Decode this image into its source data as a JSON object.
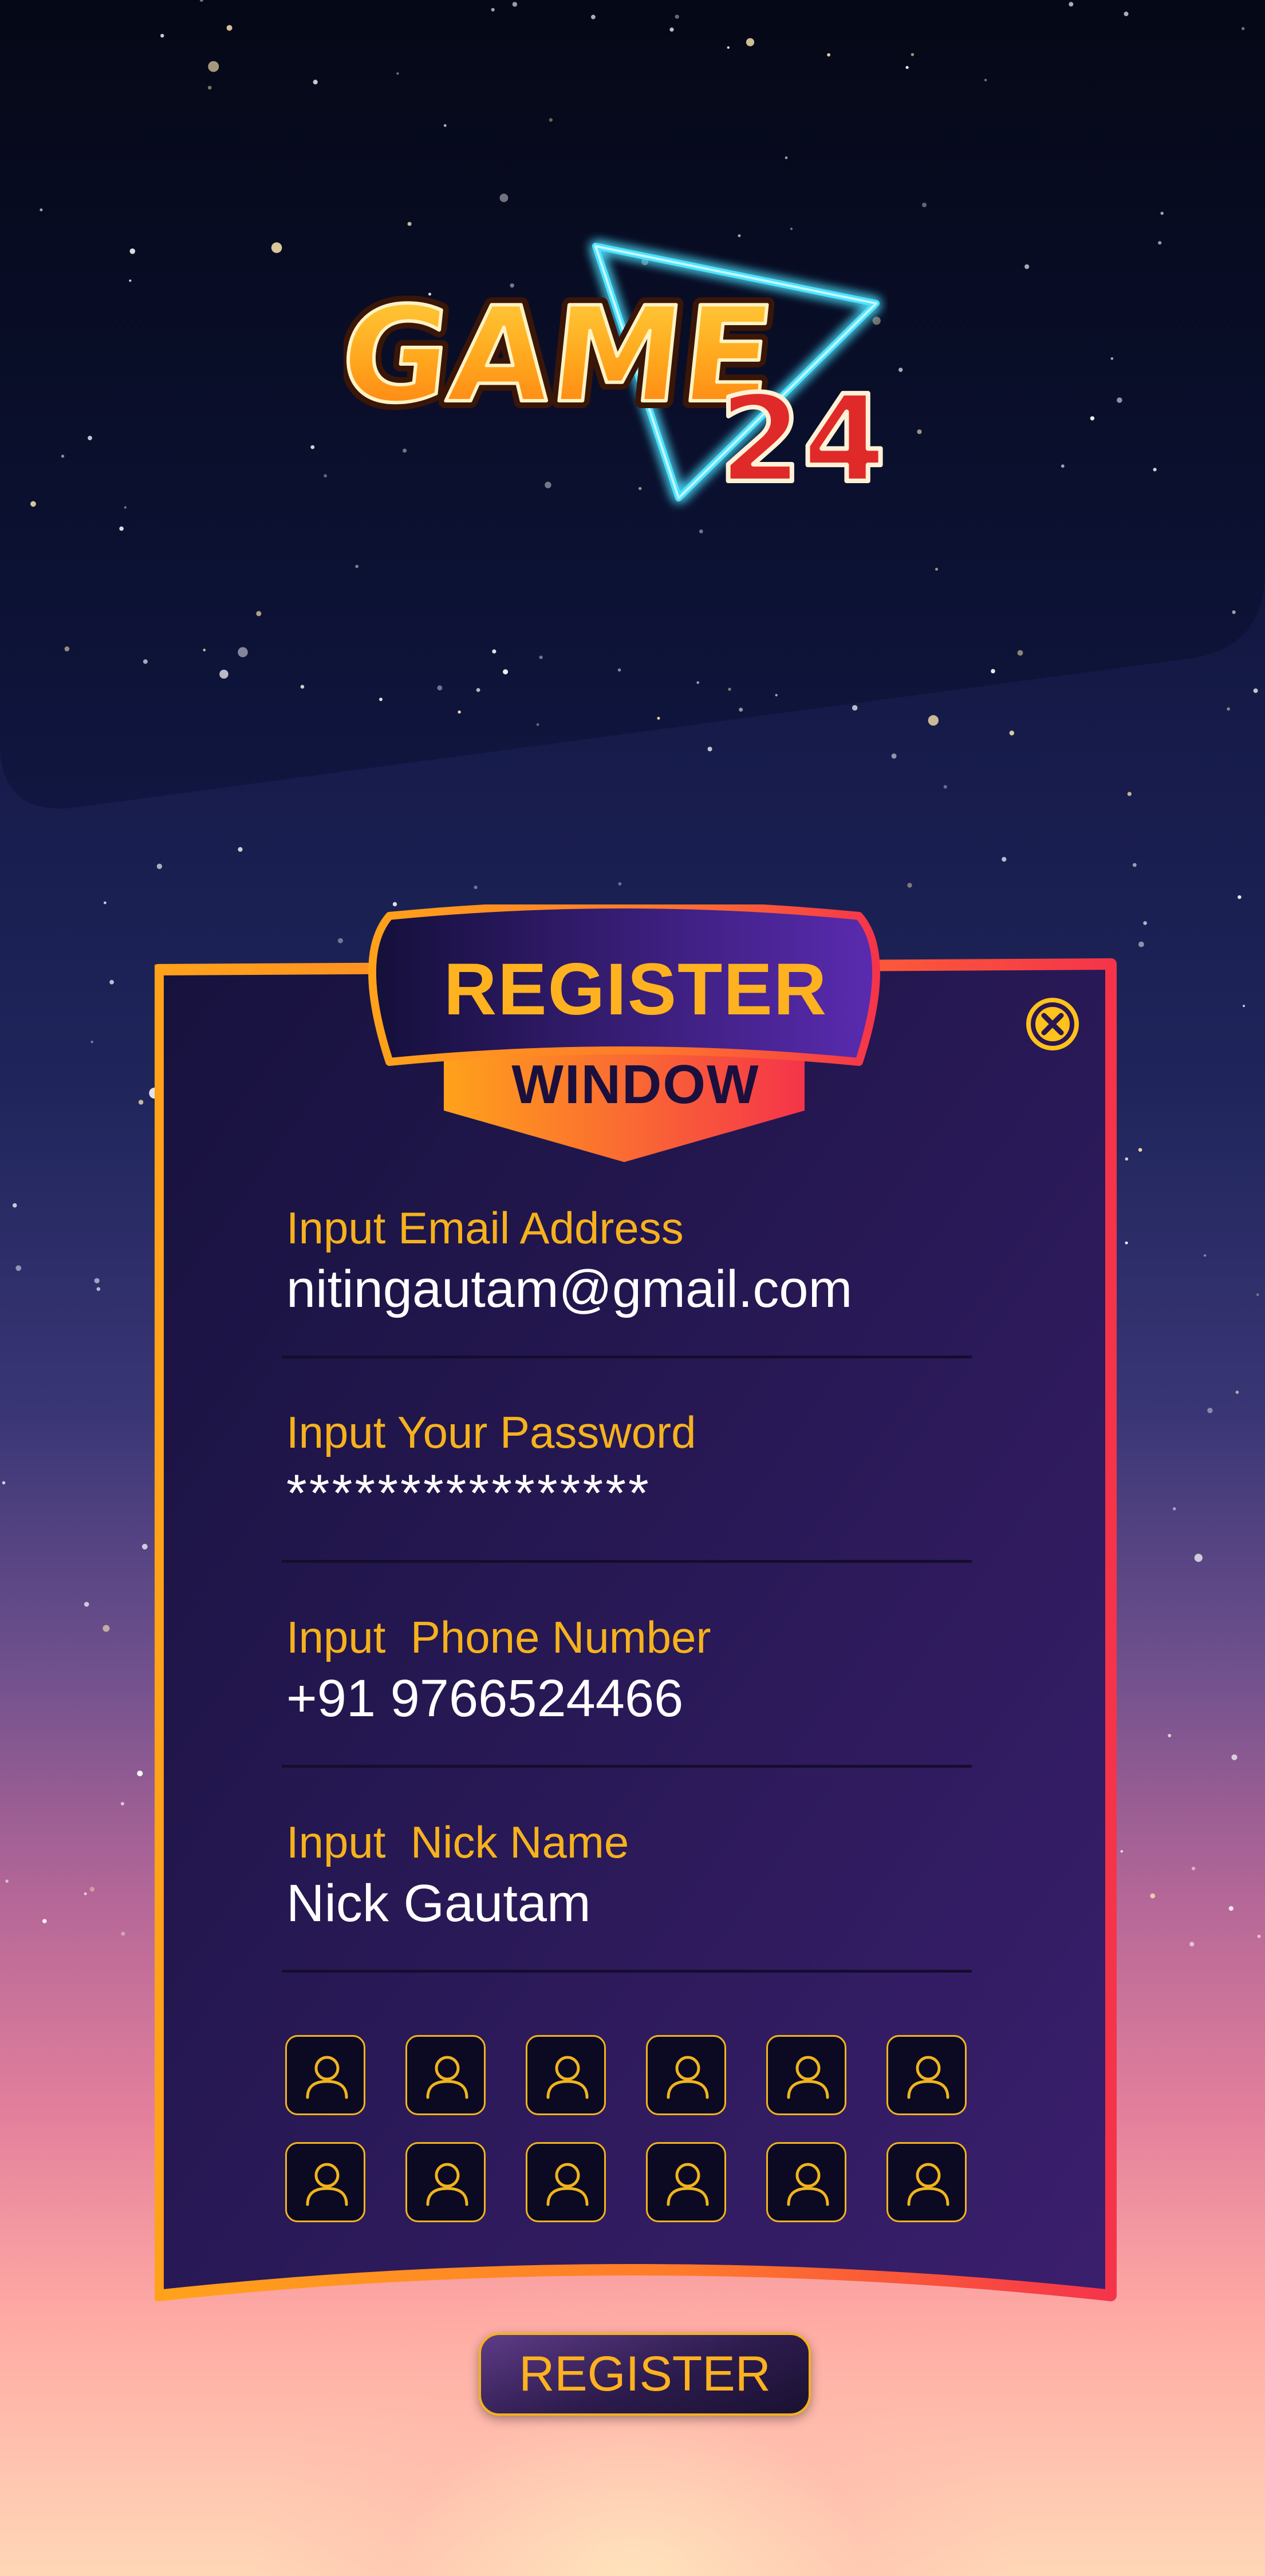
{
  "logo": {
    "word": "GAME",
    "number": "24"
  },
  "modal": {
    "badge_title": "REGISTER",
    "badge_subtitle": "WINDOW",
    "close_icon": "close-icon"
  },
  "form": {
    "email": {
      "label": "Input Email Address",
      "value": "nitingautam@gmail.com"
    },
    "password": {
      "label": "Input Your Password",
      "value": "****************"
    },
    "phone": {
      "label": "Input  Phone Number",
      "value": "+91 9766524466"
    },
    "nickname": {
      "label": "Input  Nick Name",
      "value": "Nick Gautam"
    }
  },
  "avatars": {
    "rows": 2,
    "columns": 6,
    "icon": "user-icon"
  },
  "register_button": {
    "label": "REGISTER"
  },
  "colors": {
    "accent_gold": "#ffb21f",
    "frame_orange": "#ffa21a",
    "frame_red": "#f5344a",
    "modal_bg_start": "#1a1344",
    "modal_bg_end": "#3b1f6e",
    "logo_red": "#e02a2a",
    "neon_cyan": "#4fe3ff"
  }
}
